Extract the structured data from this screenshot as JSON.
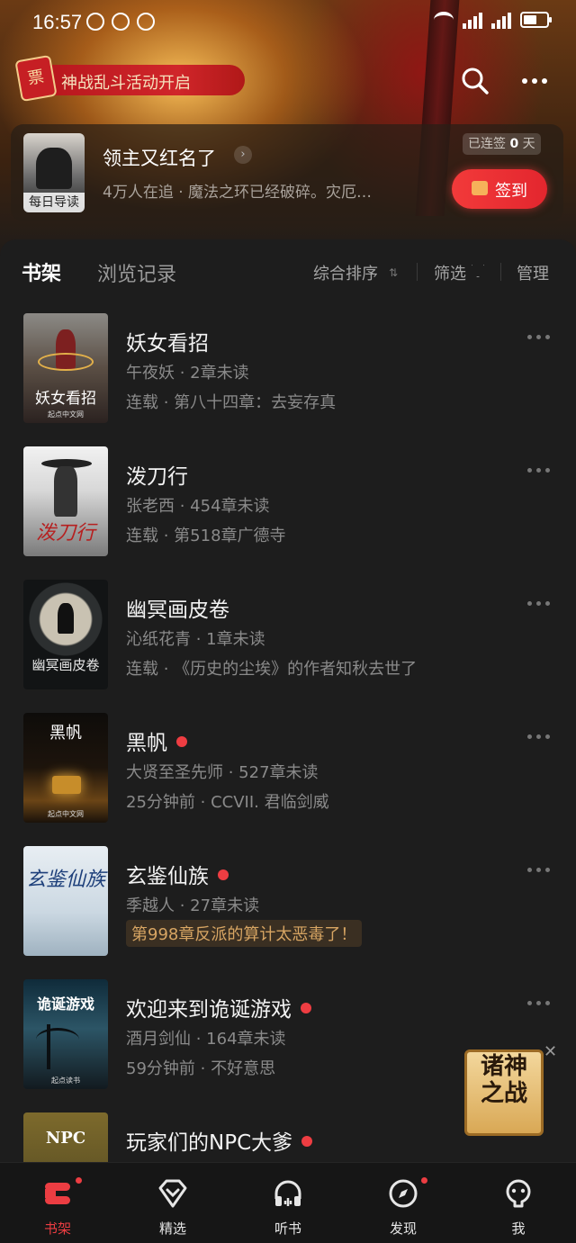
{
  "status_bar": {
    "time": "16:57",
    "network": "4G"
  },
  "banner": {
    "event_icon": "票",
    "event_label": "神战乱斗活动开启",
    "search_icon": "search-icon",
    "more_icon": "more-icon"
  },
  "daily": {
    "cover_label": "每日导读",
    "title": "领主又红名了",
    "subtitle": "4万人在追 · 魔法之环已经破碎。灾厄…",
    "streak_prefix": "已连签",
    "streak_days": "0",
    "streak_suffix": "天",
    "signin_label": "签到"
  },
  "tabs": {
    "shelf": "书架",
    "history": "浏览记录",
    "sort": "综合排序",
    "filter": "筛选",
    "manage": "管理"
  },
  "books": [
    {
      "title": "妖女看招",
      "cover_title": "妖女看招",
      "meta": "午夜妖 · 2章未读",
      "latest": "连载 · 第八十四章：去妄存真",
      "updated": false
    },
    {
      "title": "泼刀行",
      "cover_title": "泼刀行",
      "meta": "张老西 · 454章未读",
      "latest": "连载 · 第518章广德寺",
      "updated": false
    },
    {
      "title": "幽冥画皮卷",
      "cover_title": "幽冥画皮卷",
      "meta": "沁纸花青 · 1章未读",
      "latest": "连载 · 《历史的尘埃》的作者知秋去世了",
      "updated": false
    },
    {
      "title": "黑帆",
      "cover_title": "黑帆",
      "meta": "大贤至圣先师 · 527章未读",
      "latest": "25分钟前 · CCVII. 君临剑威",
      "updated": true
    },
    {
      "title": "玄鉴仙族",
      "cover_title": "玄鉴仙族",
      "meta": "季越人 · 27章未读",
      "latest": "第998章反派的算计太恶毒了！",
      "updated": true
    },
    {
      "title": "欢迎来到诡诞游戏",
      "cover_title": "诡诞游戏",
      "meta": "酒月剑仙 · 164章未读",
      "latest": "59分钟前 · 不好意思",
      "updated": true
    },
    {
      "title": "玩家们的NPC大爹",
      "cover_title": "NPC",
      "meta": "",
      "latest": "",
      "updated": true
    }
  ],
  "float_ad": {
    "text": "诸神之战",
    "close": "✕"
  },
  "bottom_nav": [
    {
      "label": "书架",
      "icon": "bookshelf-icon",
      "active": true,
      "badge": true
    },
    {
      "label": "精选",
      "icon": "diamond-icon",
      "active": false,
      "badge": false
    },
    {
      "label": "听书",
      "icon": "headphones-icon",
      "active": false,
      "badge": false
    },
    {
      "label": "发现",
      "icon": "compass-icon",
      "active": false,
      "badge": true
    },
    {
      "label": "我",
      "icon": "profile-icon",
      "active": false,
      "badge": false
    }
  ],
  "colors": {
    "accent": "#ec3d42",
    "background": "#1d1d1d",
    "highlight": "#d7a563"
  }
}
